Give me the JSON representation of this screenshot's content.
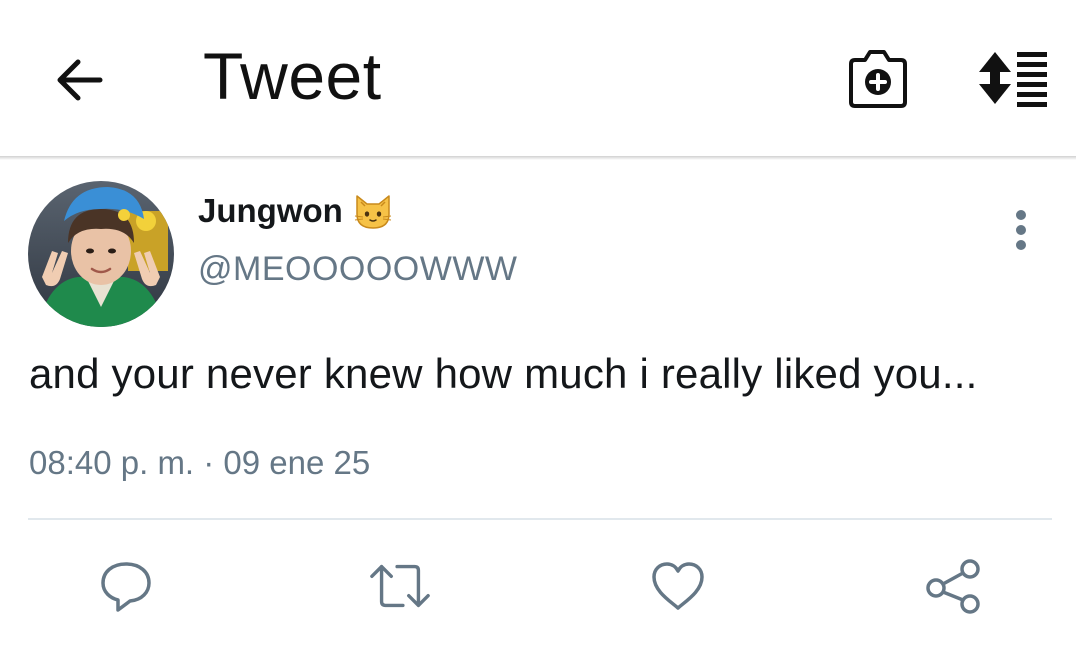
{
  "header": {
    "title": "Tweet",
    "back_icon": "arrow-left-icon",
    "camera_icon": "camera-plus-icon",
    "sort_icon": "sort-list-icon"
  },
  "tweet": {
    "author_name": "Jungwon",
    "author_emoji": "cat-face-icon",
    "handle": "@MEOOOOOWWW",
    "text": "and your never knew how much i really liked you...",
    "timestamp": "08:40 p. m. · 09 ene 25"
  },
  "actions": {
    "reply_icon": "reply-bubble-icon",
    "retweet_icon": "retweet-icon",
    "like_icon": "heart-icon",
    "share_icon": "share-icon"
  },
  "colors": {
    "text_primary": "#14171a",
    "text_secondary": "#657786",
    "divider": "#e1e8ed"
  }
}
